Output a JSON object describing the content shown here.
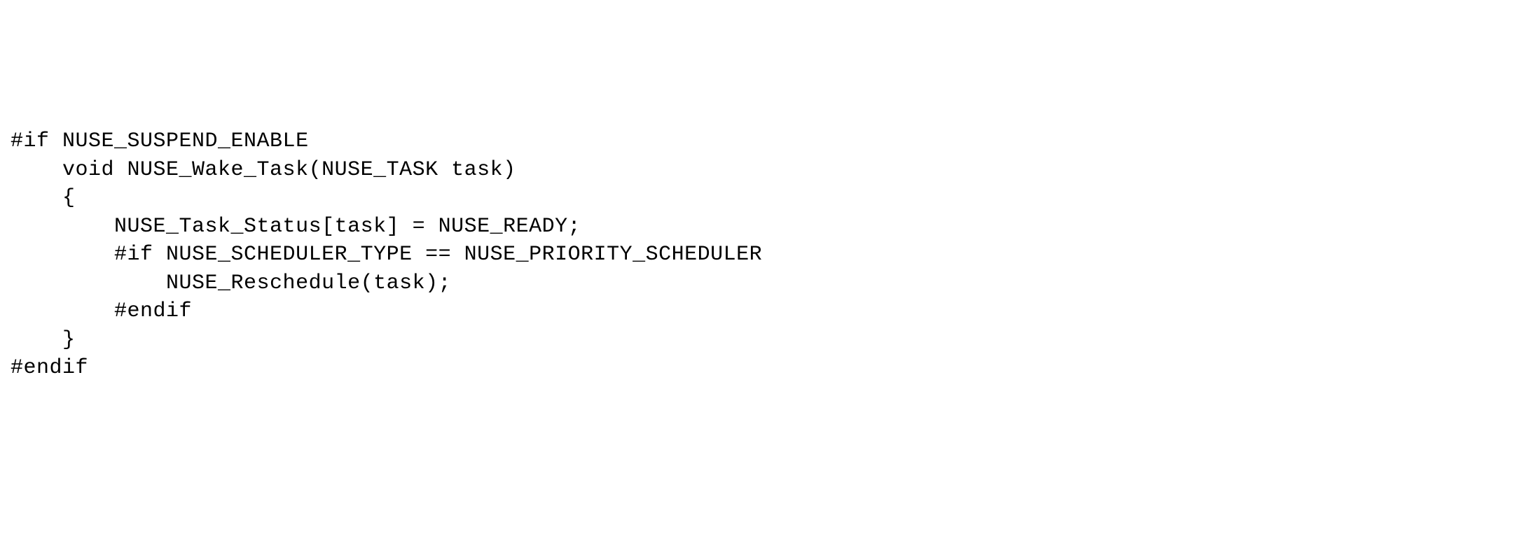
{
  "code": {
    "line1": "#if NUSE_SUSPEND_ENABLE",
    "line2": "",
    "line3": "    void NUSE_Wake_Task(NUSE_TASK task)",
    "line4": "    {",
    "line5": "        NUSE_Task_Status[task] = NUSE_READY;",
    "line6": "        #if NUSE_SCHEDULER_TYPE == NUSE_PRIORITY_SCHEDULER",
    "line7": "            NUSE_Reschedule(task);",
    "line8": "        #endif",
    "line9": "    }",
    "line10": "",
    "line11": "#endif"
  }
}
